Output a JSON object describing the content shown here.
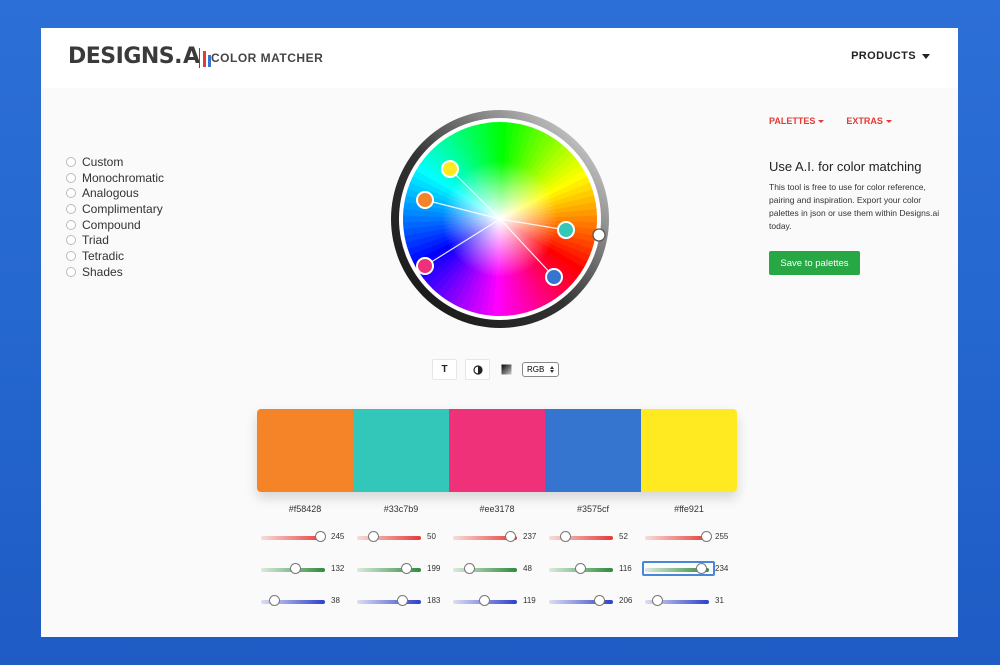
{
  "header": {
    "logo_text": "DESIGNS.",
    "logo_ai": "A",
    "app_name": "COLOR MATCHER",
    "products_label": "PRODUCTS"
  },
  "schemes": [
    "Custom",
    "Monochromatic",
    "Analogous",
    "Complimentary",
    "Compound",
    "Triad",
    "Tetradic",
    "Shades"
  ],
  "toolbar": {
    "text_button": "T",
    "color_mode": "RGB"
  },
  "swatches": [
    {
      "hex": "#f58428",
      "r": 245,
      "g": 132,
      "b": 38
    },
    {
      "hex": "#33c7b9",
      "r": 50,
      "g": 199,
      "b": 183
    },
    {
      "hex": "#ee3178",
      "r": 237,
      "g": 48,
      "b": 119
    },
    {
      "hex": "#3575cf",
      "r": 52,
      "g": 116,
      "b": 206
    },
    {
      "hex": "#ffe921",
      "r": 255,
      "g": 234,
      "b": 31
    }
  ],
  "right_panel": {
    "palettes_label": "PALETTES",
    "extras_label": "EXTRAS",
    "title": "Use A.I. for color matching",
    "description": "This tool is free to use for color reference, pairing and inspiration. Export your color palettes in json or use them within Designs.ai today.",
    "save_button": "Save to palettes"
  },
  "colors": {
    "accent_red": "#e53935",
    "save_green": "#28a745",
    "background_blue": "#2467cf"
  }
}
